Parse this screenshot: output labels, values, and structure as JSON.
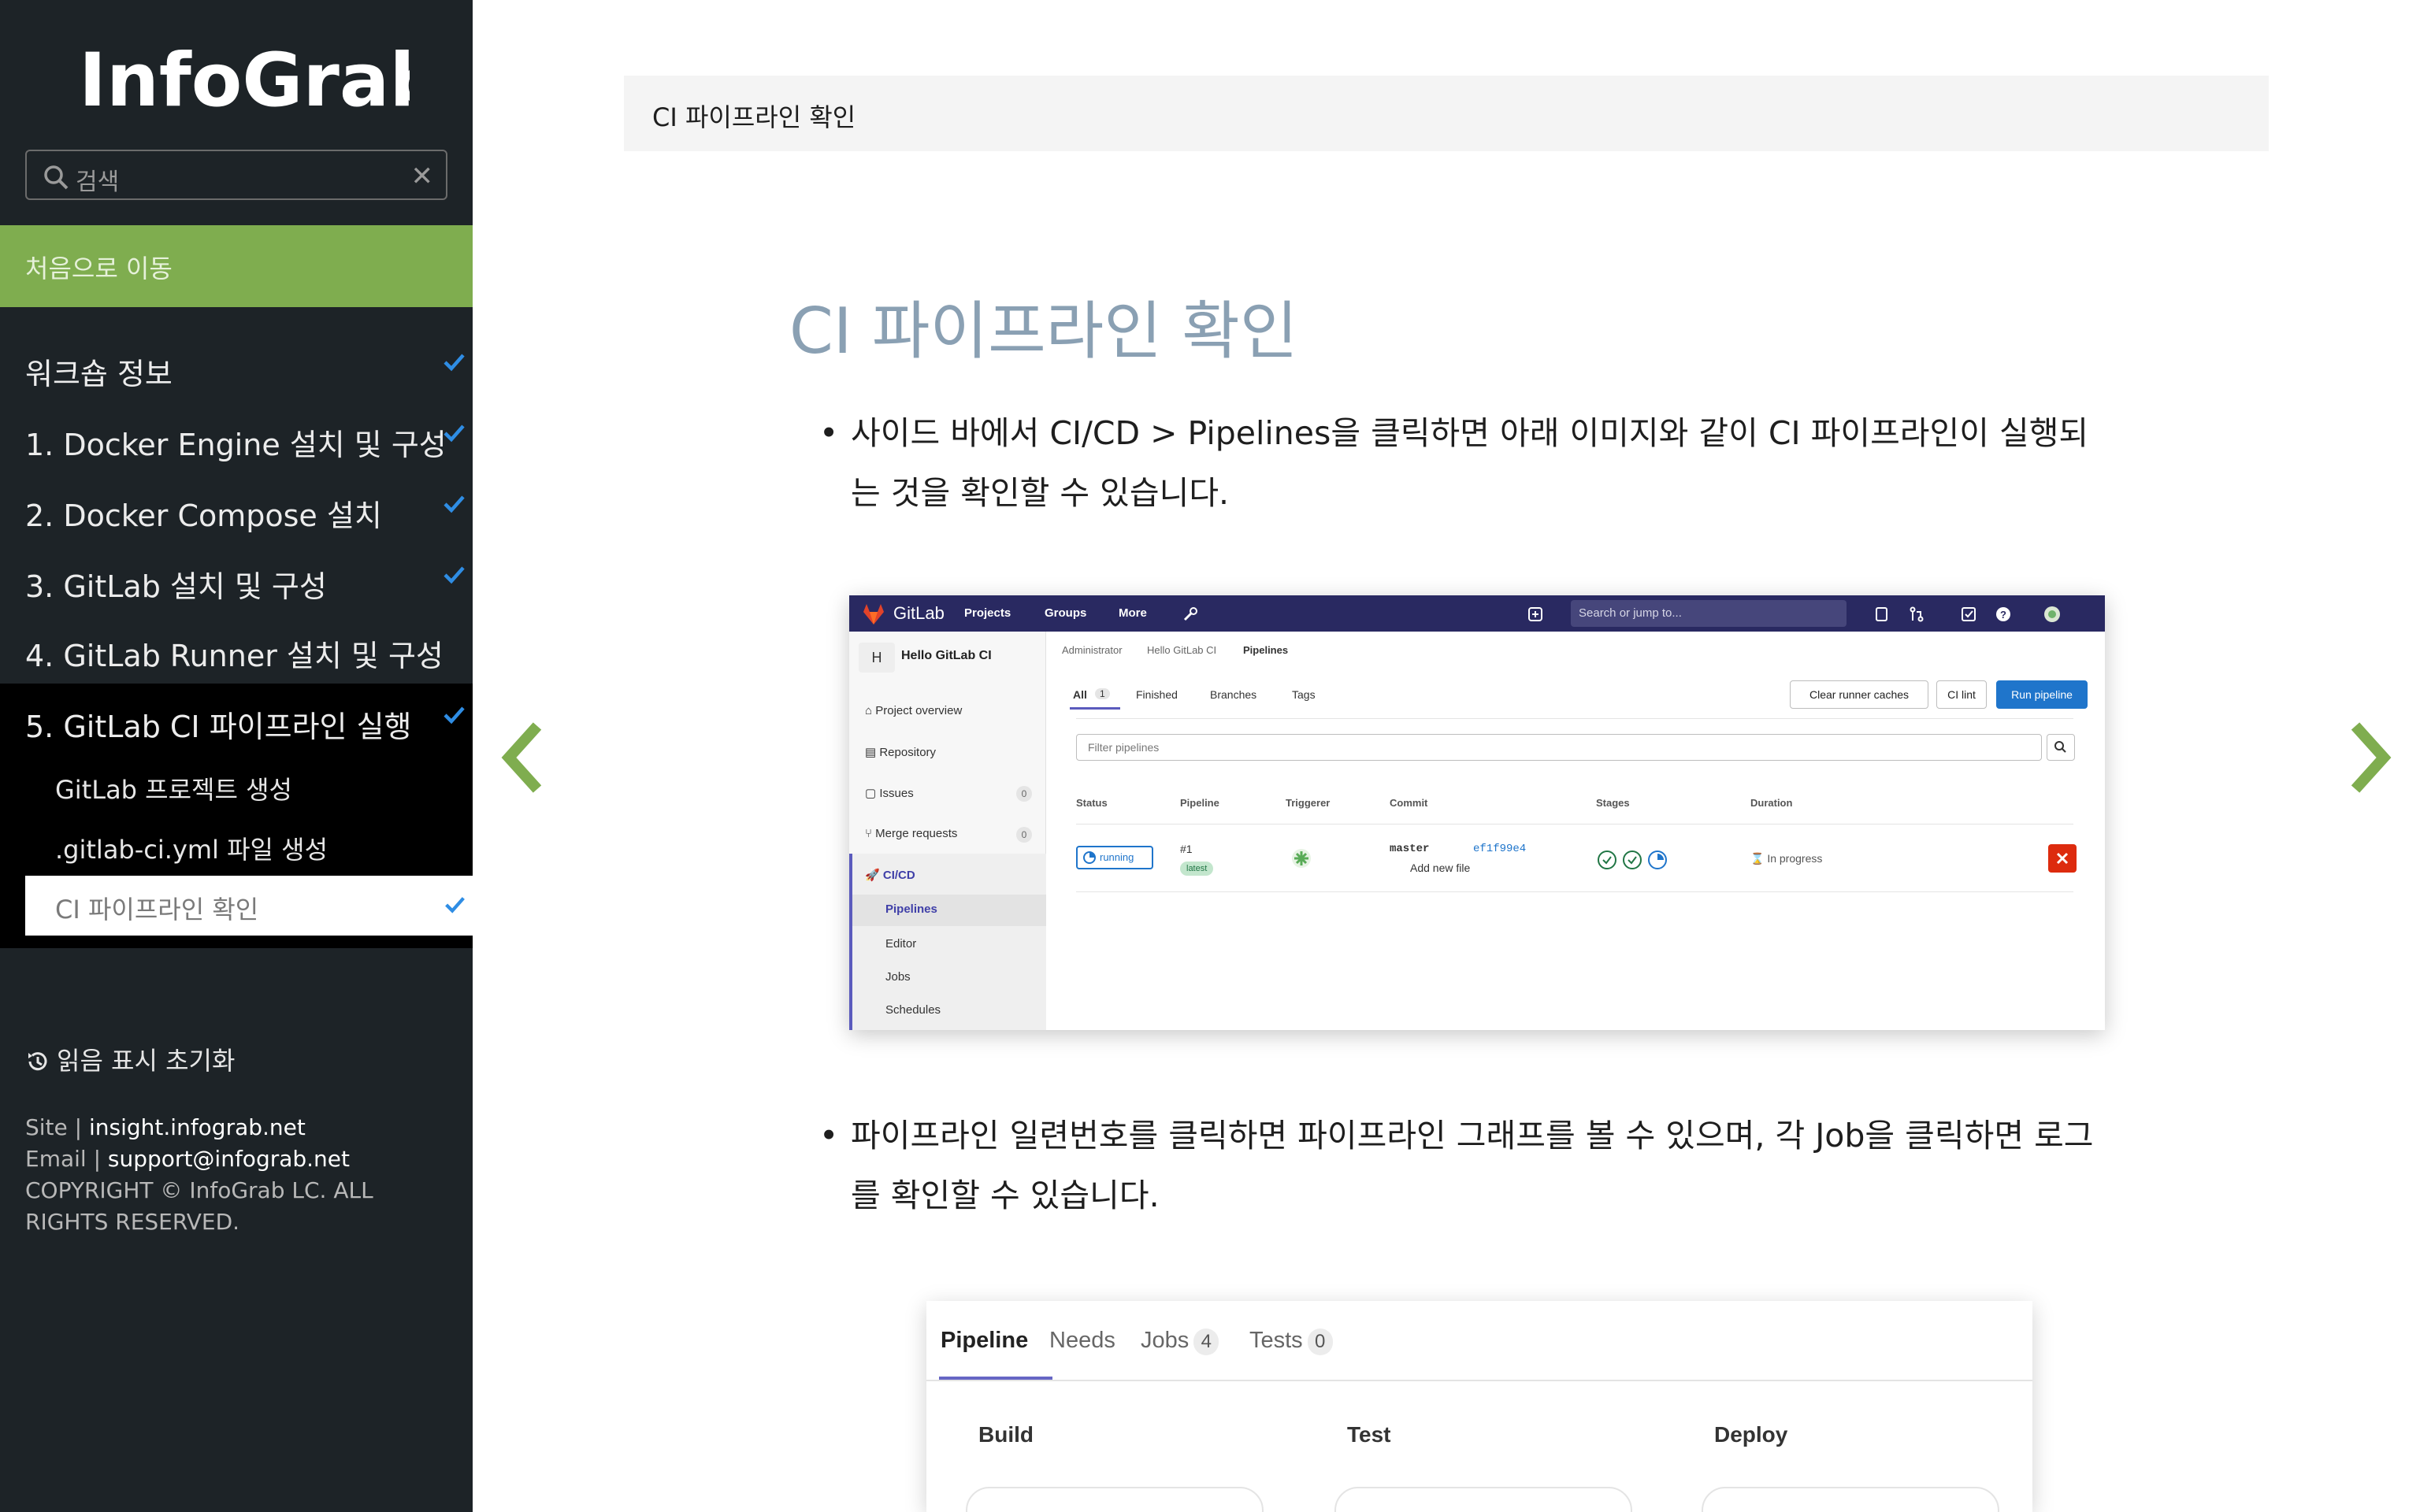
{
  "sidebar": {
    "logo_text": "InfoGrab",
    "search_placeholder": "검색",
    "home_link": "처음으로 이동",
    "items": [
      {
        "label": "워크숍 정보",
        "done": true
      },
      {
        "label": "1. Docker Engine 설치 및 구성",
        "done": true
      },
      {
        "label": "2. Docker Compose 설치",
        "done": true
      },
      {
        "label": "3. GitLab 설치 및 구성",
        "done": true
      },
      {
        "label": "4. GitLab Runner 설치 및 구성",
        "done": false
      },
      {
        "label": "5. GitLab CI 파이프라인 실행",
        "done": true
      }
    ],
    "sub_items": [
      {
        "label": "GitLab 프로젝트 생성"
      },
      {
        "label": ".gitlab-ci.yml 파일 생성"
      },
      {
        "label": "CI 파이프라인 확인",
        "current": true,
        "done": true
      }
    ],
    "reset_label": "읽음 표시 초기화",
    "footer": {
      "site_prefix": "Site | ",
      "site": "insight.infograb.net",
      "email_prefix": "Email | ",
      "email": "support@infograb.net",
      "copyright": "COPYRIGHT © InfoGrab LC. ALL RIGHTS RESERVED."
    }
  },
  "main": {
    "breadcrumb": "CI 파이프라인 확인",
    "title": "CI 파이프라인 확인",
    "paragraph1": "사이드 바에서 CI/CD > Pipelines을 클릭하면 아래 이미지와 같이 CI 파이프라인이 실행되는 것을 확인할 수 있습니다.",
    "paragraph2": "파이프라인 일련번호를 클릭하면 파이프라인 그래프를 볼 수 있으며, 각 Job을 클릭하면 로그를 확인할 수 있습니다."
  },
  "gitlab_screenshot": {
    "brand": "GitLab",
    "menus": [
      "Projects",
      "Groups",
      "More"
    ],
    "search_placeholder": "Search or jump to...",
    "project_initial": "H",
    "project_name": "Hello GitLab CI",
    "side_items": {
      "overview": "Project overview",
      "repository": "Repository",
      "issues": "Issues",
      "issues_count": "0",
      "merge_requests": "Merge requests",
      "mr_count": "0",
      "cicd": "CI/CD",
      "pipelines": "Pipelines",
      "editor": "Editor",
      "jobs": "Jobs",
      "schedules": "Schedules"
    },
    "breadcrumb": {
      "admin": "Administrator",
      "project": "Hello GitLab CI",
      "current": "Pipelines"
    },
    "tabs": {
      "all": "All",
      "all_count": "1",
      "finished": "Finished",
      "branches": "Branches",
      "tags": "Tags"
    },
    "buttons": {
      "clear": "Clear runner caches",
      "lint": "CI lint",
      "run": "Run pipeline"
    },
    "filter_placeholder": "Filter pipelines",
    "columns": {
      "status": "Status",
      "pipeline": "Pipeline",
      "triggerer": "Triggerer",
      "commit": "Commit",
      "stages": "Stages",
      "duration": "Duration"
    },
    "row": {
      "status": "running",
      "pipeline_id": "#1",
      "tag": "latest",
      "branch": "master",
      "sha": "ef1f99e4",
      "message": "Add new file",
      "duration": "In progress"
    }
  },
  "pipeline_screenshot": {
    "tabs": {
      "pipeline": "Pipeline",
      "needs": "Needs",
      "jobs": "Jobs",
      "jobs_count": "4",
      "tests": "Tests",
      "tests_count": "0"
    },
    "stages": [
      "Build",
      "Test",
      "Deploy"
    ]
  },
  "colors": {
    "sidebar_bg": "#1d2327",
    "accent_green": "#7fad4f",
    "check_blue": "#2f8de4",
    "title_color": "#8aa0b3",
    "gitlab_nav": "#292961"
  }
}
